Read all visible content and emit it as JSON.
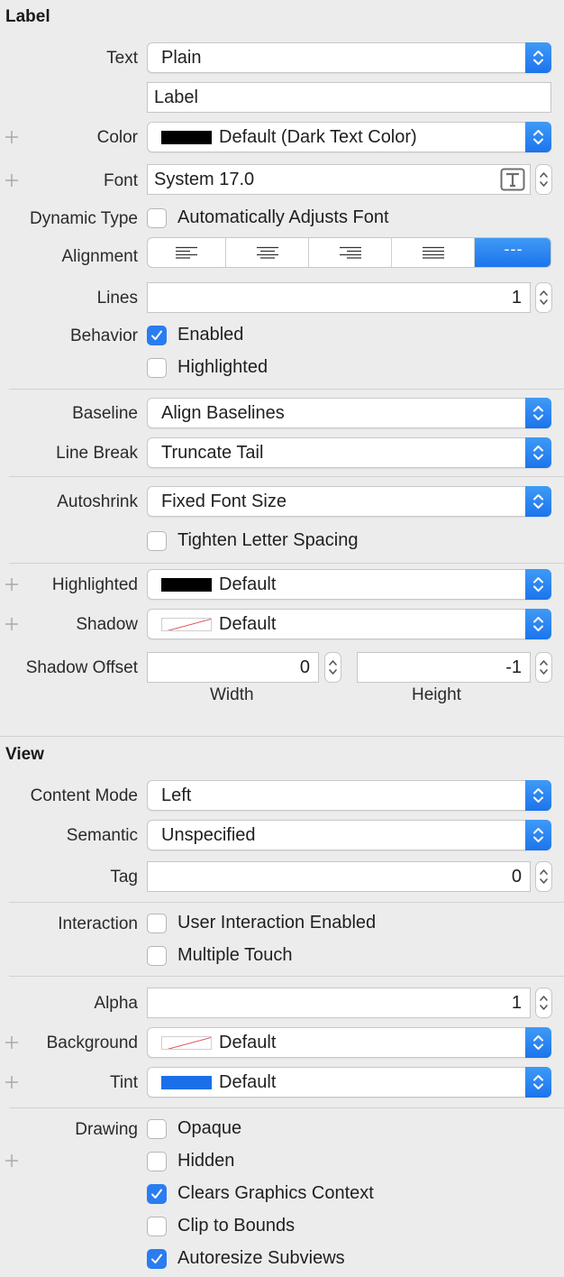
{
  "label_section": {
    "title": "Label",
    "text_label": "Text",
    "text_mode": "Plain",
    "text_value": "Label",
    "color_label": "Color",
    "color_value": "Default (Dark Text Color)",
    "font_label": "Font",
    "font_value": "System 17.0",
    "dynamic_type_label": "Dynamic Type",
    "dynamic_type_option": "Automatically Adjusts Font",
    "dynamic_type_checked": false,
    "alignment_label": "Alignment",
    "alignment_options": [
      "left",
      "center",
      "right",
      "justified",
      "natural"
    ],
    "alignment_selected": "natural",
    "natural_glyph": "---",
    "lines_label": "Lines",
    "lines_value": "1",
    "behavior_label": "Behavior",
    "enabled_label": "Enabled",
    "enabled_checked": true,
    "highlighted_label": "Highlighted",
    "highlighted_checked": false,
    "baseline_label": "Baseline",
    "baseline_value": "Align Baselines",
    "line_break_label": "Line Break",
    "line_break_value": "Truncate Tail",
    "autoshrink_label": "Autoshrink",
    "autoshrink_value": "Fixed Font Size",
    "tighten_label": "Tighten Letter Spacing",
    "tighten_checked": false,
    "highlighted_color_label": "Highlighted",
    "highlighted_color_value": "Default",
    "shadow_label": "Shadow",
    "shadow_value": "Default",
    "shadow_offset_label": "Shadow Offset",
    "shadow_width_value": "0",
    "shadow_height_value": "-1",
    "width_caption": "Width",
    "height_caption": "Height"
  },
  "view_section": {
    "title": "View",
    "content_mode_label": "Content Mode",
    "content_mode_value": "Left",
    "semantic_label": "Semantic",
    "semantic_value": "Unspecified",
    "tag_label": "Tag",
    "tag_value": "0",
    "interaction_label": "Interaction",
    "user_interaction_label": "User Interaction Enabled",
    "user_interaction_checked": false,
    "multiple_touch_label": "Multiple Touch",
    "multiple_touch_checked": false,
    "alpha_label": "Alpha",
    "alpha_value": "1",
    "background_label": "Background",
    "background_value": "Default",
    "tint_label": "Tint",
    "tint_value": "Default",
    "drawing_label": "Drawing",
    "opaque_label": "Opaque",
    "opaque_checked": false,
    "hidden_label": "Hidden",
    "hidden_checked": false,
    "clears_label": "Clears Graphics Context",
    "clears_checked": true,
    "clip_label": "Clip to Bounds",
    "clip_checked": false,
    "autoresize_label": "Autoresize Subviews",
    "autoresize_checked": true
  },
  "colors": {
    "accent": "#1c74ec",
    "tint_swatch": "#1a6fe8",
    "default_text_swatch": "#000000"
  },
  "icons": {
    "popup_arrows": "up-down-chevron-icon",
    "font_picker": "font-t-icon",
    "plus": "plus-icon",
    "check": "checkmark-icon"
  }
}
